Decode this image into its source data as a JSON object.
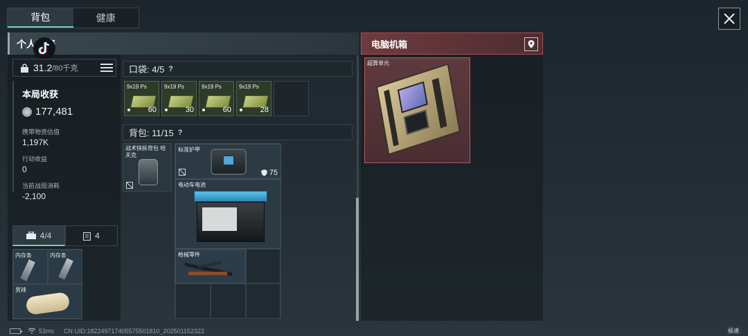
{
  "tabs": [
    {
      "label": "背包",
      "active": true
    },
    {
      "label": "健康",
      "active": false
    }
  ],
  "personal": {
    "title": "个人物资",
    "weight_current": "31.2",
    "weight_max": "/80千克"
  },
  "stats": {
    "harvest_title": "本局收获",
    "harvest_value": "177,481",
    "carry_label": "携带物资估值",
    "carry_value": "1,197K",
    "action_label": "行动收益",
    "action_value": "0",
    "consume_label": "当前战局消耗",
    "consume_value": "-2,100"
  },
  "bottom_tabs": [
    {
      "label": "4/4",
      "icon": "toolbox-icon"
    },
    {
      "label": "4",
      "icon": "clipboard-icon"
    }
  ],
  "secure_items": [
    {
      "label": "内存条"
    },
    {
      "label": "内存条"
    },
    {
      "label": "男袜"
    }
  ],
  "pocket": {
    "title": "口袋: 4/5",
    "help": "?",
    "slots": [
      {
        "name": "9x19 Ps",
        "count": "60"
      },
      {
        "name": "9x19 Ps",
        "count": "30"
      },
      {
        "name": "9x19 Ps",
        "count": "60"
      },
      {
        "name": "9x19 Ps",
        "count": "28"
      }
    ]
  },
  "backpack": {
    "title": "背包: 11/15",
    "help": "?",
    "pack_label": "战术快拆背包 哈夫克",
    "armor_label": "标准护甲",
    "armor_value": "75",
    "battery_label": "电动车电池",
    "gun_parts_label": "枪械零件"
  },
  "container": {
    "title": "电脑机箱",
    "item_label": "超算单元"
  },
  "footer": {
    "ping": "53ms",
    "uid": "CN UID:182249717405575501810_202501152322",
    "speed": "极速"
  },
  "colors": {
    "accent": "#6fd0c0",
    "container_red": "#b04a52"
  }
}
